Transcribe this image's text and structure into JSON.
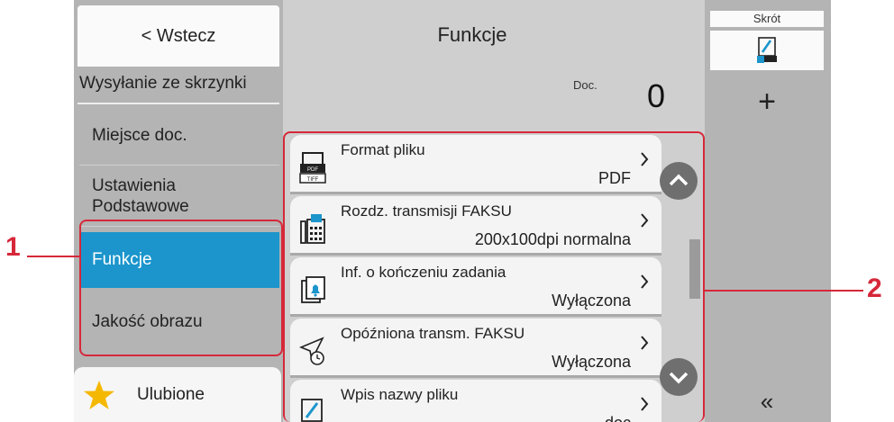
{
  "left": {
    "back_label": "< Wstecz",
    "mode_label": "Wysyłanie ze skrzynki",
    "items": [
      {
        "line1": "Miejsce doc.",
        "line2": ""
      },
      {
        "line1": "Ustawienia",
        "line2": "Podstawowe"
      },
      {
        "line1": "Funkcje",
        "line2": ""
      },
      {
        "line1": "Jakość obrazu",
        "line2": ""
      }
    ],
    "selected_item": "Funkcje",
    "favorites_label": "Ulubione"
  },
  "main": {
    "title": "Funkcje",
    "doc_label": "Doc.",
    "doc_count": "0",
    "rows": [
      {
        "title": "Format pliku",
        "value": "PDF",
        "icon": "file-format-icon"
      },
      {
        "title": "Rozdz. transmisji FAKSU",
        "value": "200x100dpi normalna",
        "icon": "fax-resolution-icon"
      },
      {
        "title": "Inf. o kończeniu zadania",
        "value": "Wyłączona",
        "icon": "job-finish-notice-icon"
      },
      {
        "title": "Opóźniona transm. FAKSU",
        "value": "Wyłączona",
        "icon": "delayed-fax-icon"
      },
      {
        "title": "Wpis nazwy pliku",
        "value": "doc",
        "icon": "file-name-icon"
      }
    ]
  },
  "right": {
    "shortcut_label": "Skrót",
    "add_label": "+",
    "collapse_label": "«"
  },
  "callouts": {
    "one": "1",
    "two": "2"
  },
  "colors": {
    "accent": "#1b95cc",
    "callout": "#d6283a",
    "star": "#f5b800"
  }
}
